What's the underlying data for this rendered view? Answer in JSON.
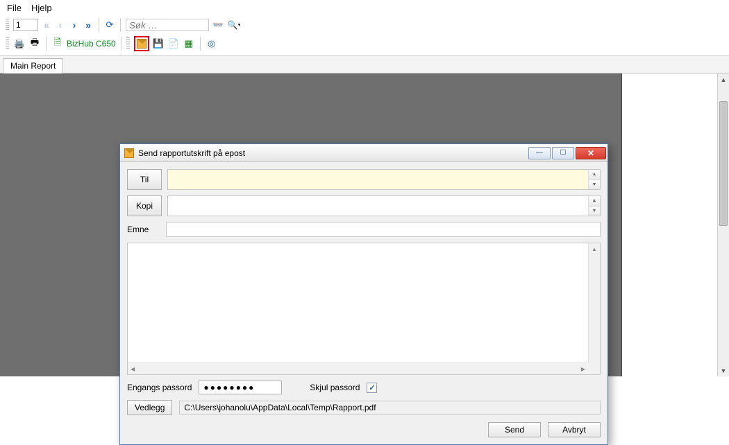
{
  "menu": {
    "file": "File",
    "help": "Hjelp"
  },
  "nav": {
    "page_value": "1",
    "search_placeholder": "Søk …"
  },
  "toolbar2": {
    "printer_name": "BizHub C650"
  },
  "tab": {
    "main": "Main Report"
  },
  "dialog": {
    "title": "Send rapportutskrift på epost",
    "to_btn": "Til",
    "copy_btn": "Kopi",
    "subject_label": "Emne",
    "to_value": "",
    "copy_value": "",
    "subject_value": "",
    "body_value": "",
    "pw_label": "Engangs passord",
    "pw_value": "●●●●●●●●",
    "hide_pw_label": "Skjul passord",
    "hide_pw_checked": "✓",
    "attach_btn": "Vedlegg",
    "attach_path": "C:\\Users\\johanolu\\AppData\\Local\\Temp\\Rapport.pdf",
    "send": "Send",
    "cancel": "Avbryt"
  }
}
